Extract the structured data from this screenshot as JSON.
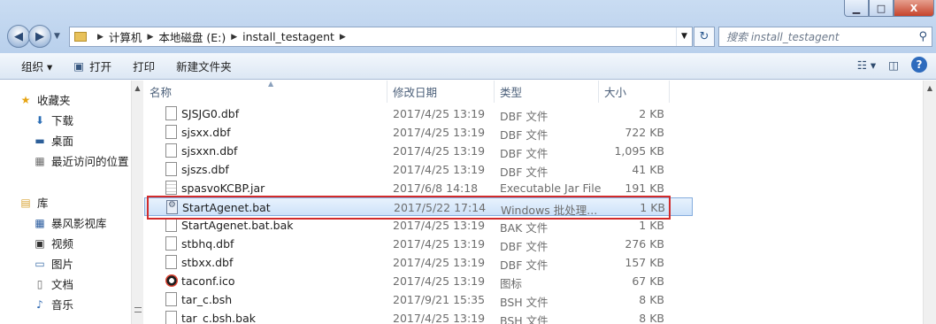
{
  "window": {
    "min": "▁",
    "max": "□",
    "close": "X"
  },
  "address": {
    "crumbs": [
      "计算机",
      "本地磁盘 (E:)",
      "install_testagent"
    ]
  },
  "search": {
    "placeholder": "搜索 install_testagent"
  },
  "toolbar": {
    "organize": "组织 ▾",
    "open": "打开",
    "print": "打印",
    "new_folder": "新建文件夹"
  },
  "sidebar": {
    "favorites": "收藏夹",
    "downloads": "下载",
    "desktop": "桌面",
    "recent": "最近访问的位置",
    "libraries": "库",
    "storm": "暴风影视库",
    "videos": "视频",
    "pictures": "图片",
    "documents": "文档",
    "music": "音乐"
  },
  "columns": {
    "name": "名称",
    "date": "修改日期",
    "type": "类型",
    "size": "大小"
  },
  "files": [
    {
      "name": "SJSJG0.dbf",
      "date": "2017/4/25 13:19",
      "type": "DBF 文件",
      "size": "2 KB",
      "icon": "doc"
    },
    {
      "name": "sjsxx.dbf",
      "date": "2017/4/25 13:19",
      "type": "DBF 文件",
      "size": "722 KB",
      "icon": "doc"
    },
    {
      "name": "sjsxxn.dbf",
      "date": "2017/4/25 13:19",
      "type": "DBF 文件",
      "size": "1,095 KB",
      "icon": "doc"
    },
    {
      "name": "sjszs.dbf",
      "date": "2017/4/25 13:19",
      "type": "DBF 文件",
      "size": "41 KB",
      "icon": "doc"
    },
    {
      "name": "spasvoKCBP.jar",
      "date": "2017/6/8 14:18",
      "type": "Executable Jar File",
      "size": "191 KB",
      "icon": "jar"
    },
    {
      "name": "StartAgenet.bat",
      "date": "2017/5/22 17:14",
      "type": "Windows 批处理...",
      "size": "1 KB",
      "icon": "bat"
    },
    {
      "name": "StartAgenet.bat.bak",
      "date": "2017/4/25 13:19",
      "type": "BAK 文件",
      "size": "1 KB",
      "icon": "doc"
    },
    {
      "name": "stbhq.dbf",
      "date": "2017/4/25 13:19",
      "type": "DBF 文件",
      "size": "276 KB",
      "icon": "doc"
    },
    {
      "name": "stbxx.dbf",
      "date": "2017/4/25 13:19",
      "type": "DBF 文件",
      "size": "157 KB",
      "icon": "doc"
    },
    {
      "name": "taconf.ico",
      "date": "2017/4/25 13:19",
      "type": "图标",
      "size": "67 KB",
      "icon": "ico"
    },
    {
      "name": "tar_c.bsh",
      "date": "2017/9/21 15:35",
      "type": "BSH 文件",
      "size": "8 KB",
      "icon": "doc"
    },
    {
      "name": "tar_c.bsh.bak",
      "date": "2017/4/25 13:19",
      "type": "BSH 文件",
      "size": "8 KB",
      "icon": "doc"
    }
  ]
}
